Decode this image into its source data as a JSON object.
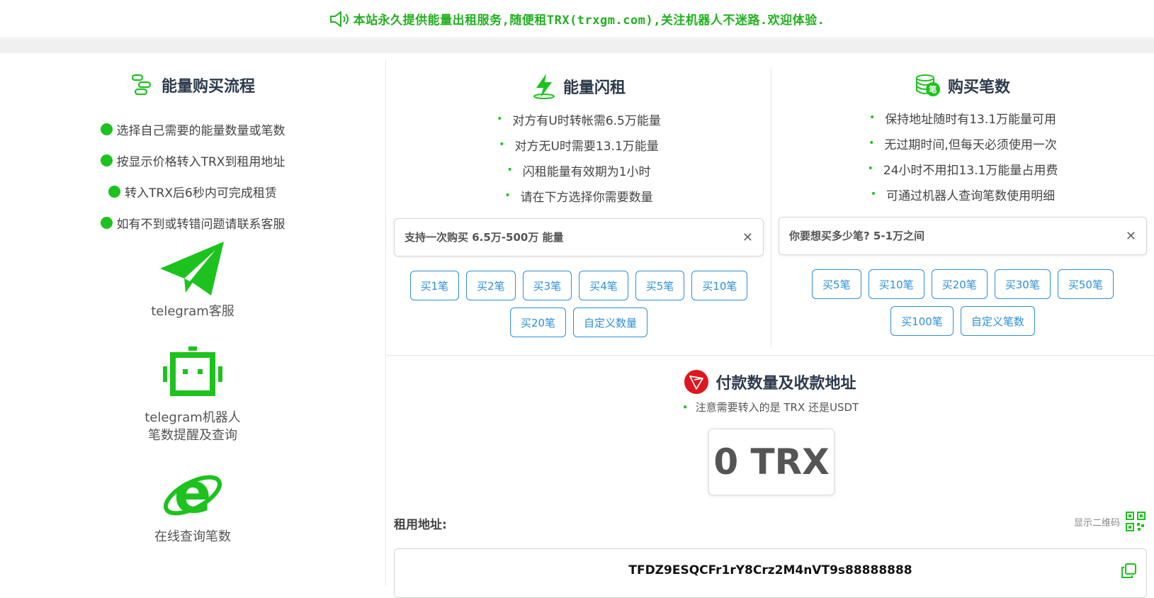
{
  "banner": {
    "text": "本站永久提供能量出租服务,随便租TRX(trxgm.com),关注机器人不迷路.欢迎体验."
  },
  "colors": {
    "green": "#1ec21e",
    "blue": "#2e8fd6",
    "tron_red": "#e0151d"
  },
  "process": {
    "title": "能量购买流程",
    "steps": [
      "选择自己需要的能量数量或笔数",
      "按显示价格转入TRX到租用地址",
      "转入TRX后6秒内可完成租赁",
      "如有不到或转错问题请联系客服"
    ],
    "telegram_support": "telegram客服",
    "telegram_bot_line1": "telegram机器人",
    "telegram_bot_line2": "笔数提醒及查询",
    "online_query": "在线查询笔数"
  },
  "flash": {
    "title": "能量闪租",
    "bullets": [
      "对方有U时转帐需6.5万能量",
      "对方无U时需要13.1万能量",
      "闪租能量有效期为1小时",
      "请在下方选择你需要数量"
    ],
    "placeholder": "支持一次购买 6.5万-500万 能量",
    "buttons": [
      "买1笔",
      "买2笔",
      "买3笔",
      "买4笔",
      "买5笔",
      "买10笔",
      "买20笔",
      "自定义数量"
    ]
  },
  "count": {
    "title": "购买笔数",
    "bullets": [
      "保持地址随时有13.1万能量可用",
      "无过期时间,但每天必须使用一次",
      "24小时不用扣13.1万能量占用费",
      "可通过机器人查询笔数使用明细"
    ],
    "placeholder": "你要想买多少笔? 5-1万之间",
    "buttons": [
      "买5笔",
      "买10笔",
      "买20笔",
      "买30笔",
      "买50笔",
      "买100笔",
      "自定义笔数"
    ]
  },
  "payment": {
    "title": "付款数量及收款地址",
    "note": "注意需要转入的是 TRX 还是USDT",
    "amount": "0 TRX",
    "address_label": "租用地址:",
    "show_qr": "显示二维码",
    "address": "TFDZ9ESQCFr1rY8Crz2M4nVT9s88888888"
  }
}
